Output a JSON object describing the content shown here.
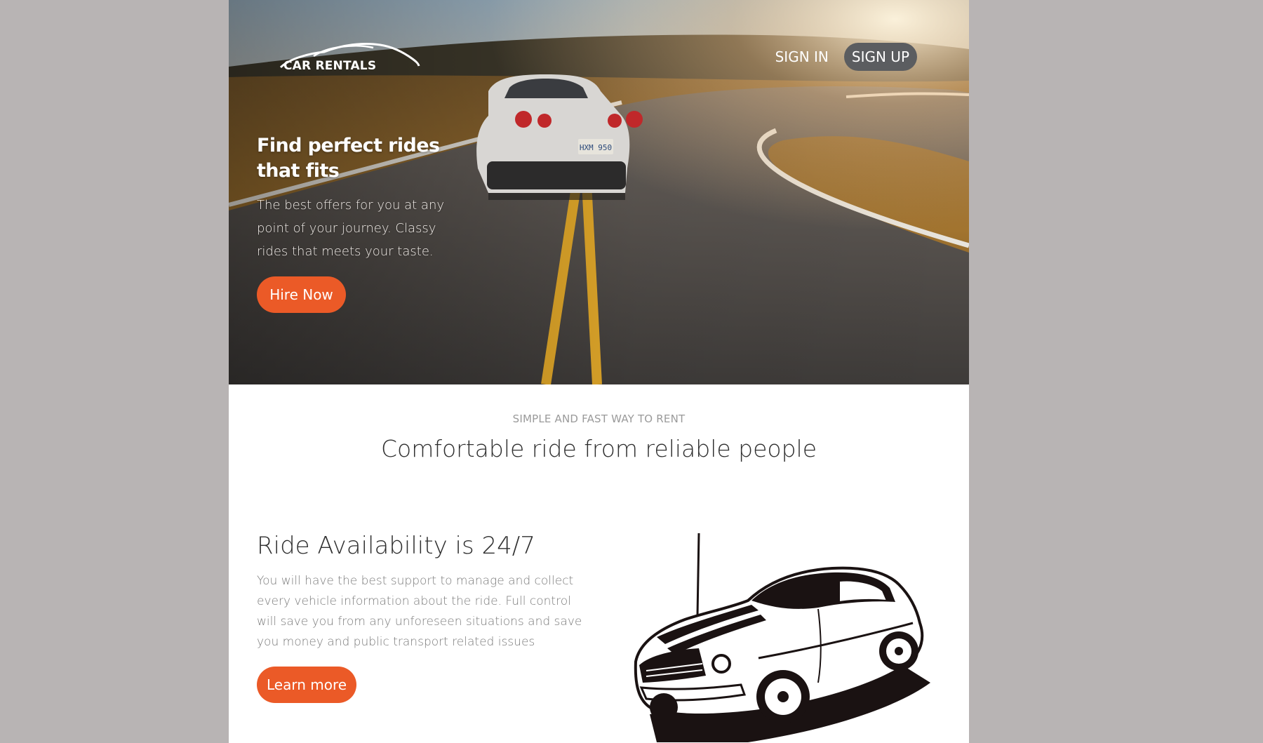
{
  "brand": {
    "logo_text": "CAR RENTALS"
  },
  "nav": {
    "sign_in": "SIGN IN",
    "sign_up": "SIGN UP"
  },
  "hero": {
    "title": "Find perfect rides that fits",
    "subtitle": "The best offers for you at any point of your journey. Classy rides that meets your taste.",
    "cta": "Hire Now",
    "plate_text": "HXM 950"
  },
  "section": {
    "eyebrow": "SIMPLE AND FAST WAY TO RENT",
    "title": "Comfortable ride from reliable people"
  },
  "feature": {
    "title": "Ride Availability is 24/7",
    "text": "You will have the best support to manage and collect every vehicle information about the ride. Full control will save you from any unforeseen situations and save you money and public transport related issues",
    "cta": "Learn more"
  },
  "colors": {
    "accent": "#eb5a27",
    "signup_bg": "#5b5d60",
    "page_bg": "#b8b4b4"
  }
}
